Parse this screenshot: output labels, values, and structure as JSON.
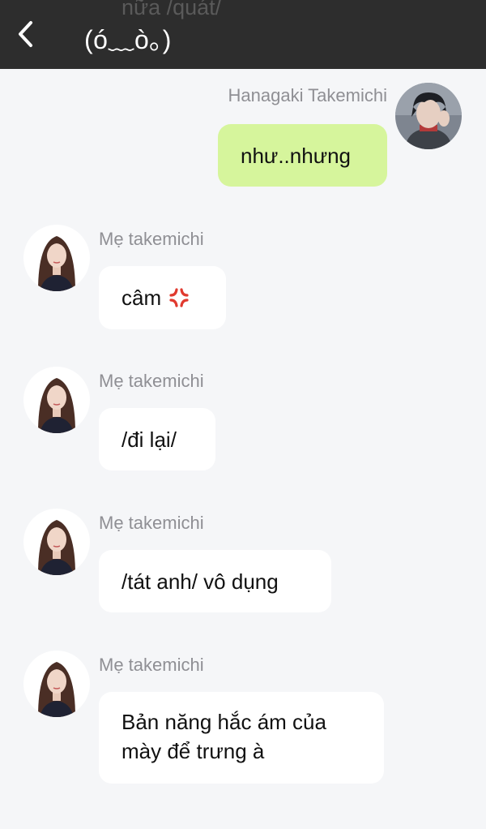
{
  "header": {
    "ghost_text": "nữa /quát/",
    "title": "(ó﹏ò｡)",
    "back_icon": "chevron-left-icon"
  },
  "colors": {
    "header_bg": "#2d2d2d",
    "page_bg": "#f5f6f8",
    "outgoing_bubble": "#d6f59c",
    "incoming_bubble": "#ffffff",
    "name_text": "#8f8f94"
  },
  "messages": [
    {
      "sender": "Hanagaki Takemichi",
      "direction": "outgoing",
      "text": "như..nhưng"
    },
    {
      "sender": "Mẹ takemichi",
      "direction": "incoming",
      "text": "câm",
      "emoji": "anger-symbol-icon"
    },
    {
      "sender": "Mẹ takemichi",
      "direction": "incoming",
      "text": "/đi lại/"
    },
    {
      "sender": "Mẹ takemichi",
      "direction": "incoming",
      "text": "/tát anh/ vô dụng"
    },
    {
      "sender": "Mẹ takemichi",
      "direction": "incoming",
      "text_lines": [
        "Bản năng hắc ám của",
        "mày để trưng à"
      ]
    }
  ]
}
